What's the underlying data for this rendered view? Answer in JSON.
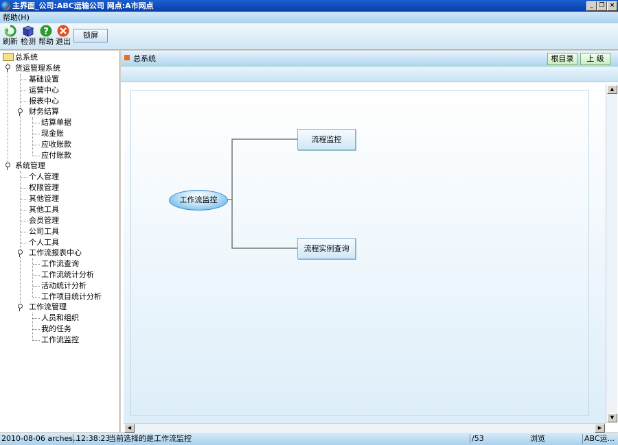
{
  "window": {
    "title": "主界面_公司:ABC运输公司  网点:A市网点"
  },
  "menu": {
    "help": "帮助(H)"
  },
  "toolbar": {
    "refresh": "刷新",
    "check": "检测",
    "help": "帮助",
    "exit": "退出",
    "lock": "锁屏"
  },
  "tree": {
    "root": "总系统",
    "freight": "货运管理系统",
    "basic_settings": "基础设置",
    "ops_center": "运营中心",
    "report_center": "报表中心",
    "finance": "财务结算",
    "settle_docs": "结算单据",
    "cash_account": "现金账",
    "receivable": "应收账款",
    "payable": "应付账款",
    "system_mgmt": "系统管理",
    "personal_mgmt": "个人管理",
    "permission_mgmt": "权限管理",
    "other_mgmt": "其他管理",
    "other_tools": "其他工具",
    "member_mgmt": "会员管理",
    "company_tools": "公司工具",
    "personal_tools": "个人工具",
    "wf_report_center": "工作流报表中心",
    "wf_query": "工作流查询",
    "wf_stats": "工作流统计分析",
    "activity_stats": "活动统计分析",
    "work_item_stats": "工作项目统计分析",
    "wf_mgmt": "工作流管理",
    "staff_org": "人员和组织",
    "my_tasks": "我的任务",
    "wf_monitor": "工作流监控"
  },
  "main": {
    "title": "总系统",
    "root_dir": "根目录",
    "up_level": "上 级"
  },
  "diagram": {
    "center": "工作流监控",
    "top_node": "流程监控",
    "bottom_node": "流程实例查询"
  },
  "status": {
    "datetime_user": "2010-08-06 arches...",
    "time": "12:38:23",
    "message": "当前选择的是工作流监控",
    "page": "/53",
    "mode": "浏览",
    "company": "ABC运..."
  }
}
